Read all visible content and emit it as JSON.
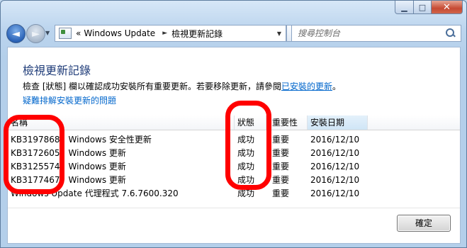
{
  "window": {
    "minimize_glyph": "▁",
    "maximize_glyph": "□",
    "close_glyph": "✕"
  },
  "nav": {
    "back_glyph": "◄",
    "forward_glyph": "►",
    "history_glyph": "▼",
    "breadcrumb": [
      "«",
      "Windows Update",
      "檢視更新記錄"
    ],
    "breadcrumb_sep": "►",
    "dropdown_glyph": "▼",
    "refresh_glyph": "↻",
    "search_placeholder": "搜尋控制台"
  },
  "page": {
    "title": "檢視更新記錄",
    "description_prefix": "檢查 [狀態] 欄以確認成功安裝所有重要更新。若要移除更新，請參閱",
    "description_link": "已安裝的更新",
    "description_suffix": "。",
    "troubleshoot_link": "疑難排解安裝更新的問題"
  },
  "table": {
    "columns": [
      "名稱",
      "狀態",
      "重要性",
      "安裝日期"
    ],
    "sorted_column_index": 3,
    "rows": [
      {
        "name": "KB3197868：Windows 安全性更新",
        "status": "成功",
        "importance": "重要",
        "date": "2016/12/10"
      },
      {
        "name": "KB3172605：Windows 更新",
        "status": "成功",
        "importance": "重要",
        "date": "2016/12/10"
      },
      {
        "name": "KB3125574：Windows 更新",
        "status": "成功",
        "importance": "重要",
        "date": "2016/12/10"
      },
      {
        "name": "KB3177467：Windows 更新",
        "status": "成功",
        "importance": "重要",
        "date": "2016/12/10"
      },
      {
        "name": "Windows Update 代理程式 7.6.7600.320",
        "status": "成功",
        "importance": "重要",
        "date": "2016/12/10"
      }
    ]
  },
  "buttons": {
    "ok_label": "確定"
  },
  "colors": {
    "annotation": "#ff0000",
    "link": "#0066cc",
    "title": "#1e3b78"
  }
}
